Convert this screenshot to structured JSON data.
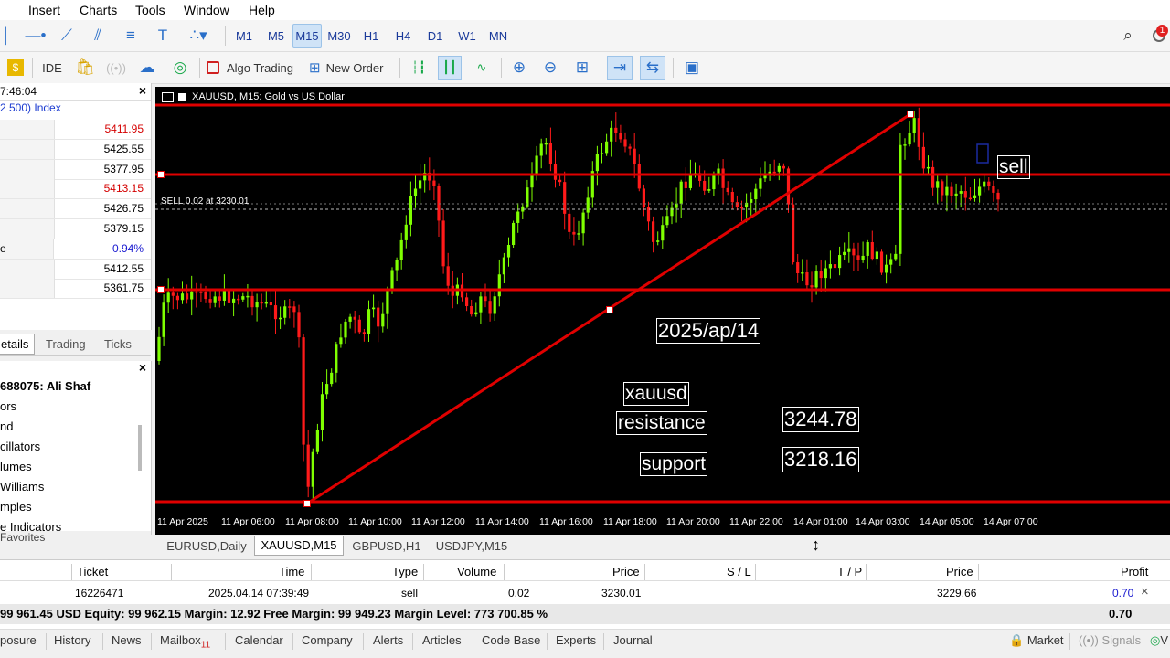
{
  "menu": [
    "Insert",
    "Charts",
    "Tools",
    "Window",
    "Help"
  ],
  "timeframes": [
    "M1",
    "M5",
    "M15",
    "M30",
    "H1",
    "H4",
    "D1",
    "W1",
    "MN"
  ],
  "active_timeframe": "M15",
  "toolbar2": {
    "ide": "IDE",
    "algo_trading": "Algo Trading",
    "new_order": "New Order"
  },
  "notification_count": "1",
  "market_watch": {
    "time": "7:46:04",
    "index_label": "2 500) Index",
    "values": [
      "5411.95",
      "5425.55",
      "5377.95",
      "5413.15",
      "5426.75",
      "5379.15",
      "0.94%",
      "5412.55",
      "5361.75"
    ],
    "row6_label": "e",
    "value_colors": [
      "#d40000",
      "#000000",
      "#000000",
      "#d40000",
      "#000000",
      "#000000",
      "#1a1ad0",
      "#000000",
      "#000000"
    ]
  },
  "market_tabs": [
    "etails",
    "Trading",
    "Ticks"
  ],
  "navigator": {
    "account": "688075: Ali Shaf",
    "items": [
      "ors",
      "nd",
      "cillators",
      "lumes",
      "Williams",
      "mples",
      "e Indicators"
    ],
    "favorites": "Favorites"
  },
  "chart": {
    "title": "XAUUSD, M15:  Gold vs US Dollar",
    "order_line": "SELL 0.02 at 3230.01",
    "texts": {
      "date": "2025/ap/14",
      "symbol": "xauusd",
      "resistance": "resistance",
      "support": "support",
      "resistance_price": "3244.78",
      "support_price": "3218.16",
      "sell": "sell"
    },
    "x_labels": [
      "11 Apr 2025",
      "11 Apr 06:00",
      "11 Apr 08:00",
      "11 Apr 10:00",
      "11 Apr 12:00",
      "11 Apr 14:00",
      "11 Apr 16:00",
      "11 Apr 18:00",
      "11 Apr 20:00",
      "11 Apr 22:00",
      "14 Apr 01:00",
      "14 Apr 03:00",
      "14 Apr 05:00",
      "14 Apr 07:00"
    ],
    "colors": {
      "bull": "#7fff00",
      "bear": "#ff1a1a",
      "line": "#e00000",
      "bg": "#000000"
    }
  },
  "chart_tabs": [
    "EURUSD,Daily",
    "XAUUSD,M15",
    "GBPUSD,H1",
    "USDJPY,M15"
  ],
  "active_chart_tab": "XAUUSD,M15",
  "trade": {
    "headers": [
      "Ticket",
      "Time",
      "Type",
      "Volume",
      "Price",
      "S / L",
      "T / P",
      "Price",
      "Profit"
    ],
    "row": [
      "16226471",
      "2025.04.14 07:39:49",
      "sell",
      "0.02",
      "3230.01",
      "",
      "",
      "3229.66",
      "0.70"
    ],
    "balance_text": "99 961.45 USD  Equity: 99 962.15  Margin: 12.92  Free Margin: 99 949.23  Margin Level: 773 700.85 %",
    "balance_profit": "0.70"
  },
  "bottom_tabs": [
    "posure",
    "History",
    "News",
    "Mailbox",
    "Calendar",
    "Company",
    "Alerts",
    "Articles",
    "Code Base",
    "Experts",
    "Journal"
  ],
  "mailbox_count": "11",
  "bottom_right": {
    "market": "Market",
    "signals": "Signals",
    "more": "V"
  }
}
